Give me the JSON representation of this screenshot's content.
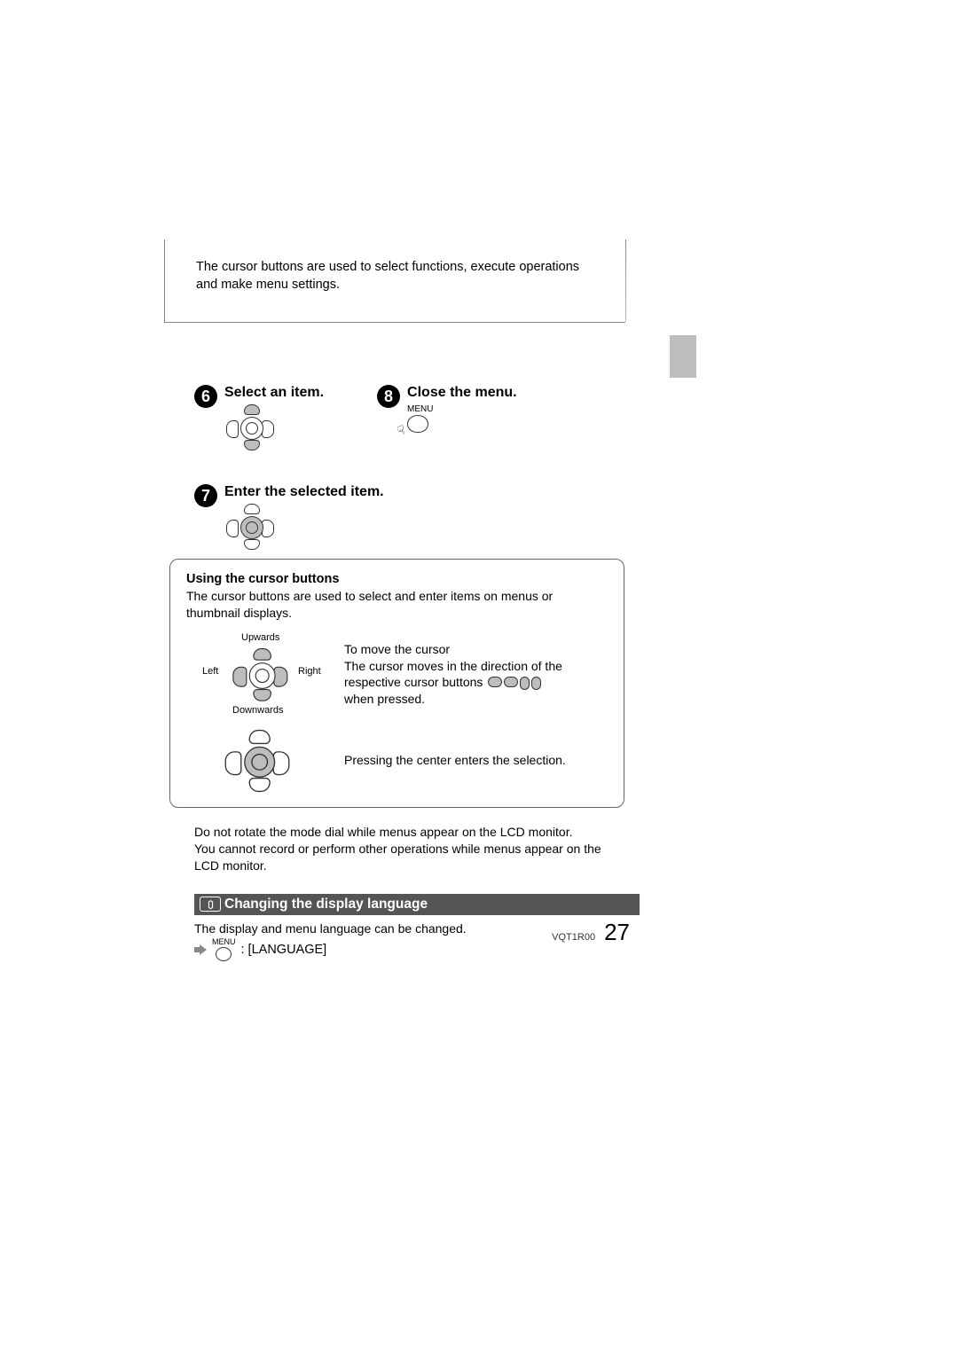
{
  "intro": "The cursor buttons are used to select functions, execute operations and make menu settings.",
  "steps": {
    "six": {
      "num": "6",
      "title": "Select an item."
    },
    "seven": {
      "num": "7",
      "title": "Enter the selected item."
    },
    "eight": {
      "num": "8",
      "title": "Close the menu.",
      "menu_label": "MENU"
    }
  },
  "cursor_box": {
    "title": "Using the cursor buttons",
    "desc": "The cursor buttons are used to select and enter items on menus or thumbnail displays.",
    "labels": {
      "up": "Upwards",
      "down": "Downwards",
      "left": "Left",
      "right": "Right"
    },
    "move_text1": "To move the cursor",
    "move_text2a": "The cursor moves in the direction of the respective cursor buttons",
    "move_text2b": "when pressed.",
    "press_text": "Pressing the center enters the selection."
  },
  "notes_line1": "Do not rotate the mode dial while menus appear on the LCD monitor.",
  "notes_line2": "You cannot record or perform other operations while menus appear on the LCD monitor.",
  "lang_section": {
    "band": "Changing the display language",
    "desc": "The display and menu language can be changed.",
    "menu_label": "MENU",
    "path": ": [LANGUAGE]"
  },
  "footer": {
    "code": "VQT1R00",
    "page": "27"
  }
}
